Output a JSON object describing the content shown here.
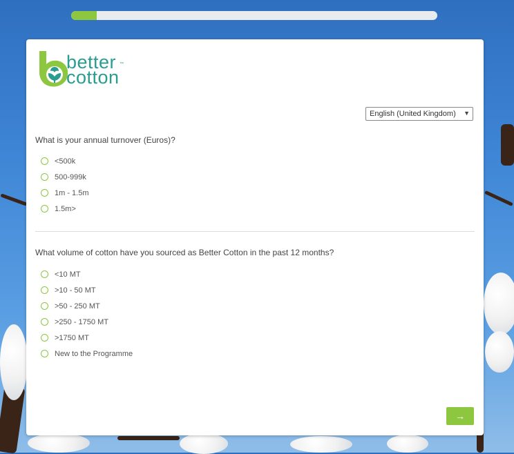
{
  "progress": {
    "value": 0.07,
    "color": "#8dc63f"
  },
  "brand": {
    "line1": "better",
    "line2": "cotton",
    "trademark": "™",
    "color": "#2a9d8f"
  },
  "language": {
    "selected": "English (United Kingdom)"
  },
  "questions": [
    {
      "text": "What is your annual turnover (Euros)?",
      "options": [
        "<500k",
        "500-999k",
        "1m - 1.5m",
        "1.5m>"
      ]
    },
    {
      "text": "What volume of cotton have you sourced as Better Cotton in the past 12 months?",
      "options": [
        "<10 MT",
        ">10 - 50 MT",
        ">50 - 250 MT",
        ">250 - 1750 MT",
        ">1750 MT",
        "New to the Programme"
      ]
    }
  ],
  "next_button": {
    "label": "→"
  },
  "colors": {
    "accent": "#8dc63f",
    "sky": "#3f86d6"
  }
}
